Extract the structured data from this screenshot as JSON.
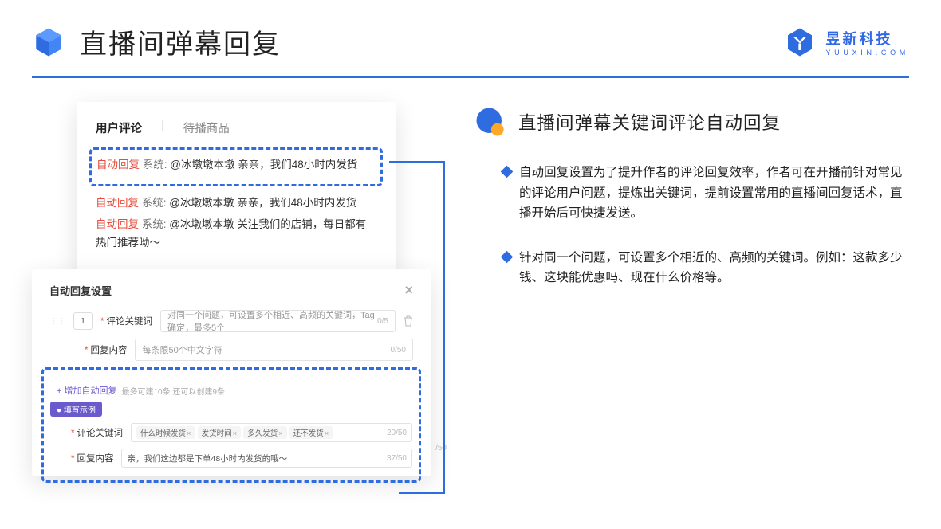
{
  "header": {
    "title": "直播间弹幕回复",
    "brand_name": "昱新科技",
    "brand_sub": "YUUXIN.COM"
  },
  "card_top": {
    "tab1": "用户评论",
    "tab2": "待播商品",
    "c1_tag": "自动回复",
    "c1_sys": "系统:",
    "c1_text": "@冰墩墩本墩 亲亲，我们48小时内发货",
    "c2_tag": "自动回复",
    "c2_sys": "系统:",
    "c2_text": "@冰墩墩本墩 亲亲，我们48小时内发货",
    "c3_tag": "自动回复",
    "c3_sys": "系统:",
    "c3_text": "@冰墩墩本墩 关注我们的店铺，每日都有热门推荐呦～"
  },
  "card_bottom": {
    "title": "自动回复设置",
    "num": "1",
    "l_keyword": "评论关键词",
    "ph_keyword": "对同一个问题，可设置多个相近、高频的关键词，Tag确定，最多5个",
    "cnt_keyword": "0/5",
    "l_content": "回复内容",
    "ph_content": "每条限50个中文字符",
    "cnt_content": "0/50",
    "add": "+ 增加自动回复",
    "add_hint": "最多可建10条 还可以创建9条",
    "badge": "● 填写示例",
    "ex_l_kw": "评论关键词",
    "ex_cnt_kw": "20/50",
    "tag1": "什么时候发货",
    "tag2": "发货时间",
    "tag3": "多久发货",
    "tag4": "还不发货",
    "ex_l_ct": "回复内容",
    "ex_content": "亲，我们这边都是下单48小时内发货的哦～",
    "ex_cnt_ct": "37/50",
    "extra_count": "/50"
  },
  "right": {
    "sec_title": "直播间弹幕关键词评论自动回复",
    "b1": "自动回复设置为了提升作者的评论回复效率，作者可在开播前针对常见的评论用户问题，提炼出关键词，提前设置常用的直播间回复话术，直播开始后可快捷发送。",
    "b2": "针对同一个问题，可设置多个相近的、高频的关键词。例如：这款多少钱、这块能优惠吗、现在什么价格等。"
  }
}
